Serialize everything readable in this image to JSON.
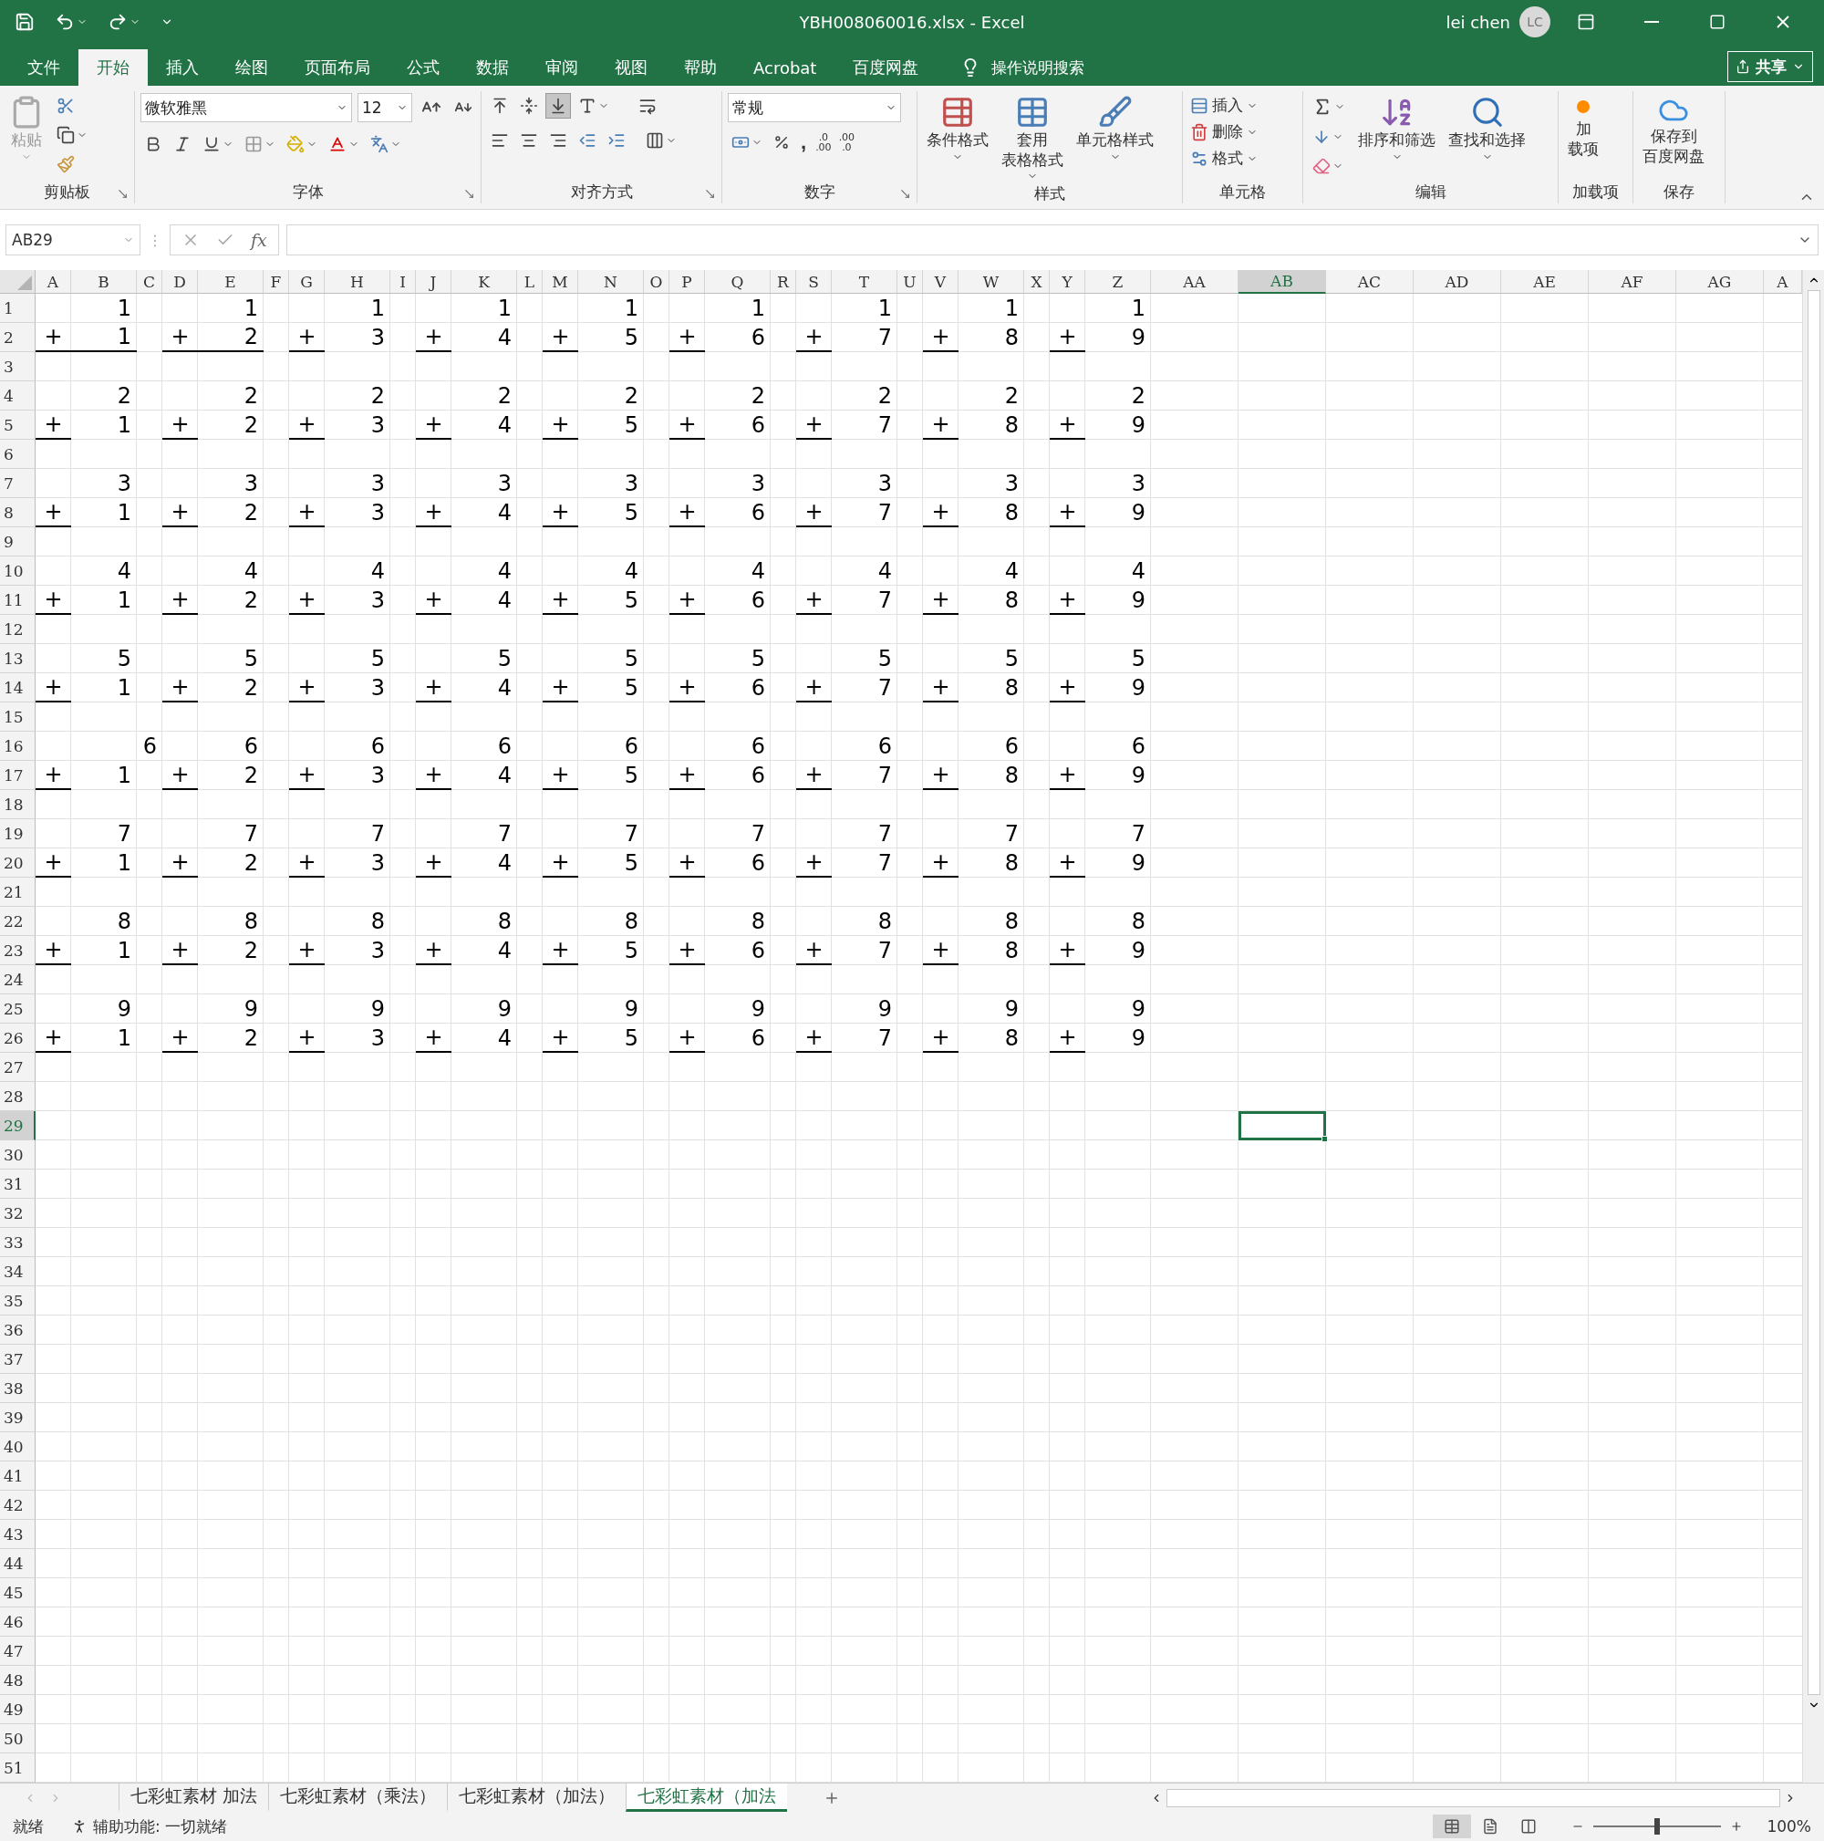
{
  "title_bar": {
    "title": "YBH008060016.xlsx  -  Excel",
    "user": "lei chen",
    "avatar": "LC"
  },
  "menu_tabs": [
    {
      "label": "文件",
      "selected": false
    },
    {
      "label": "开始",
      "selected": true
    },
    {
      "label": "插入",
      "selected": false
    },
    {
      "label": "绘图",
      "selected": false
    },
    {
      "label": "页面布局",
      "selected": false
    },
    {
      "label": "公式",
      "selected": false
    },
    {
      "label": "数据",
      "selected": false
    },
    {
      "label": "审阅",
      "selected": false
    },
    {
      "label": "视图",
      "selected": false
    },
    {
      "label": "帮助",
      "selected": false
    },
    {
      "label": "Acrobat",
      "selected": false
    },
    {
      "label": "百度网盘",
      "selected": false
    }
  ],
  "tell_me": "操作说明搜索",
  "share": "共享",
  "ribbon": {
    "clipboard": {
      "label": "剪贴板",
      "paste": "粘贴"
    },
    "font": {
      "label": "字体",
      "font_name": "微软雅黑",
      "font_size": "12"
    },
    "alignment": {
      "label": "对齐方式",
      "vertical": [
        {
          "kind": "top",
          "selected": false
        },
        {
          "kind": "middle",
          "selected": false
        },
        {
          "kind": "bottom",
          "selected": true
        }
      ]
    },
    "number": {
      "label": "数字",
      "format": "常规",
      "comma": ",",
      "increase_decimal": [
        ".0",
        ".00"
      ],
      "decrease_decimal": [
        ".00",
        ".0"
      ]
    },
    "styles": {
      "label": "样式",
      "buttons": [
        {
          "kind": "conditional",
          "label_lines": [
            "条件格式"
          ]
        },
        {
          "kind": "table",
          "label_lines": [
            "套用",
            "表格格式"
          ]
        },
        {
          "kind": "cell",
          "label_lines": [
            "单元格样式"
          ]
        }
      ]
    },
    "cells": {
      "label": "单元格",
      "buttons": [
        {
          "kind": "insert",
          "label": "插入"
        },
        {
          "kind": "delete",
          "label": "删除"
        },
        {
          "kind": "format",
          "label": "格式"
        }
      ]
    },
    "editing": {
      "label": "编辑",
      "sort": "排序和筛选",
      "find": "查找和选择"
    },
    "addins": {
      "label": "加载项",
      "button_lines": [
        "加",
        "载项"
      ]
    },
    "save": {
      "label": "保存",
      "button_lines": [
        "保存到",
        "百度网盘"
      ]
    }
  },
  "formula_bar": {
    "name_box": "AB29",
    "splitter": "⋮",
    "fx": "fx"
  },
  "columns": [
    {
      "name": "A",
      "selected": false
    },
    {
      "name": "B",
      "selected": false
    },
    {
      "name": "C",
      "selected": false
    },
    {
      "name": "D",
      "selected": false
    },
    {
      "name": "E",
      "selected": false
    },
    {
      "name": "F",
      "selected": false
    },
    {
      "name": "G",
      "selected": false
    },
    {
      "name": "H",
      "selected": false
    },
    {
      "name": "I",
      "selected": false
    },
    {
      "name": "J",
      "selected": false
    },
    {
      "name": "K",
      "selected": false
    },
    {
      "name": "L",
      "selected": false
    },
    {
      "name": "M",
      "selected": false
    },
    {
      "name": "N",
      "selected": false
    },
    {
      "name": "O",
      "selected": false
    },
    {
      "name": "P",
      "selected": false
    },
    {
      "name": "Q",
      "selected": false
    },
    {
      "name": "R",
      "selected": false
    },
    {
      "name": "S",
      "selected": false
    },
    {
      "name": "T",
      "selected": false
    },
    {
      "name": "U",
      "selected": false
    },
    {
      "name": "V",
      "selected": false
    },
    {
      "name": "W",
      "selected": false
    },
    {
      "name": "X",
      "selected": false
    },
    {
      "name": "Y",
      "selected": false
    },
    {
      "name": "Z",
      "selected": false
    },
    {
      "name": "AA",
      "selected": false
    },
    {
      "name": "AB",
      "selected": true
    },
    {
      "name": "AC",
      "selected": false
    },
    {
      "name": "AD",
      "selected": false
    },
    {
      "name": "AE",
      "selected": false
    },
    {
      "name": "AF",
      "selected": false
    },
    {
      "name": "AG",
      "selected": false
    },
    {
      "name": "A",
      "selected": false
    }
  ],
  "rows": [
    {
      "number": "1",
      "selected": false,
      "cells": {
        "B": {
          "text": "1",
          "bottom_border": false
        },
        "E": {
          "text": "1",
          "bottom_border": false
        },
        "H": {
          "text": "1",
          "bottom_border": false
        },
        "K": {
          "text": "1",
          "bottom_border": false
        },
        "N": {
          "text": "1",
          "bottom_border": false
        },
        "Q": {
          "text": "1",
          "bottom_border": false
        },
        "T": {
          "text": "1",
          "bottom_border": false
        },
        "W": {
          "text": "1",
          "bottom_border": false
        },
        "Z": {
          "text": "1",
          "bottom_border": false
        }
      }
    },
    {
      "number": "2",
      "selected": false,
      "cells": {
        "A": {
          "text": "+",
          "bottom_border": true
        },
        "B": {
          "text": "1",
          "bottom_border": true
        },
        "D": {
          "text": "+",
          "bottom_border": true
        },
        "E": {
          "text": "2",
          "bottom_border": true
        },
        "G": {
          "text": "+",
          "bottom_border": true
        },
        "H": {
          "text": "3",
          "bottom_border": false
        },
        "J": {
          "text": "+",
          "bottom_border": true
        },
        "K": {
          "text": "4",
          "bottom_border": false
        },
        "M": {
          "text": "+",
          "bottom_border": true
        },
        "N": {
          "text": "5",
          "bottom_border": false
        },
        "P": {
          "text": "+",
          "bottom_border": true
        },
        "Q": {
          "text": "6",
          "bottom_border": false
        },
        "S": {
          "text": "+",
          "bottom_border": true
        },
        "T": {
          "text": "7",
          "bottom_border": false
        },
        "V": {
          "text": "+",
          "bottom_border": true
        },
        "W": {
          "text": "8",
          "bottom_border": false
        },
        "Y": {
          "text": "+",
          "bottom_border": true
        },
        "Z": {
          "text": "9",
          "bottom_border": false
        }
      }
    },
    {
      "number": "3",
      "selected": false
    },
    {
      "number": "4",
      "selected": false,
      "cells": {
        "B": {
          "text": "2",
          "bottom_border": false
        },
        "E": {
          "text": "2",
          "bottom_border": false
        },
        "H": {
          "text": "2",
          "bottom_border": false
        },
        "K": {
          "text": "2",
          "bottom_border": false
        },
        "N": {
          "text": "2",
          "bottom_border": false
        },
        "Q": {
          "text": "2",
          "bottom_border": false
        },
        "T": {
          "text": "2",
          "bottom_border": false
        },
        "W": {
          "text": "2",
          "bottom_border": false
        },
        "Z": {
          "text": "2",
          "bottom_border": false
        }
      }
    },
    {
      "number": "5",
      "selected": false,
      "cells": {
        "A": {
          "text": "+",
          "bottom_border": true
        },
        "B": {
          "text": "1",
          "bottom_border": false
        },
        "D": {
          "text": "+",
          "bottom_border": true
        },
        "E": {
          "text": "2",
          "bottom_border": false
        },
        "G": {
          "text": "+",
          "bottom_border": true
        },
        "H": {
          "text": "3",
          "bottom_border": false
        },
        "J": {
          "text": "+",
          "bottom_border": true
        },
        "K": {
          "text": "4",
          "bottom_border": false
        },
        "M": {
          "text": "+",
          "bottom_border": true
        },
        "N": {
          "text": "5",
          "bottom_border": false
        },
        "P": {
          "text": "+",
          "bottom_border": true
        },
        "Q": {
          "text": "6",
          "bottom_border": false
        },
        "S": {
          "text": "+",
          "bottom_border": true
        },
        "T": {
          "text": "7",
          "bottom_border": false
        },
        "V": {
          "text": "+",
          "bottom_border": true
        },
        "W": {
          "text": "8",
          "bottom_border": false
        },
        "Y": {
          "text": "+",
          "bottom_border": true
        },
        "Z": {
          "text": "9",
          "bottom_border": false
        }
      }
    },
    {
      "number": "6",
      "selected": false
    },
    {
      "number": "7",
      "selected": false,
      "cells": {
        "B": {
          "text": "3",
          "bottom_border": false
        },
        "E": {
          "text": "3",
          "bottom_border": false
        },
        "H": {
          "text": "3",
          "bottom_border": false
        },
        "K": {
          "text": "3",
          "bottom_border": false
        },
        "N": {
          "text": "3",
          "bottom_border": false
        },
        "Q": {
          "text": "3",
          "bottom_border": false
        },
        "T": {
          "text": "3",
          "bottom_border": false
        },
        "W": {
          "text": "3",
          "bottom_border": false
        },
        "Z": {
          "text": "3",
          "bottom_border": false
        }
      }
    },
    {
      "number": "8",
      "selected": false,
      "cells": {
        "A": {
          "text": "+",
          "bottom_border": true
        },
        "B": {
          "text": "1",
          "bottom_border": false
        },
        "D": {
          "text": "+",
          "bottom_border": true
        },
        "E": {
          "text": "2",
          "bottom_border": false
        },
        "G": {
          "text": "+",
          "bottom_border": true
        },
        "H": {
          "text": "3",
          "bottom_border": false
        },
        "J": {
          "text": "+",
          "bottom_border": true
        },
        "K": {
          "text": "4",
          "bottom_border": false
        },
        "M": {
          "text": "+",
          "bottom_border": true
        },
        "N": {
          "text": "5",
          "bottom_border": false
        },
        "P": {
          "text": "+",
          "bottom_border": true
        },
        "Q": {
          "text": "6",
          "bottom_border": false
        },
        "S": {
          "text": "+",
          "bottom_border": true
        },
        "T": {
          "text": "7",
          "bottom_border": false
        },
        "V": {
          "text": "+",
          "bottom_border": true
        },
        "W": {
          "text": "8",
          "bottom_border": false
        },
        "Y": {
          "text": "+",
          "bottom_border": true
        },
        "Z": {
          "text": "9",
          "bottom_border": false
        }
      }
    },
    {
      "number": "9",
      "selected": false
    },
    {
      "number": "10",
      "selected": false,
      "cells": {
        "B": {
          "text": "4",
          "bottom_border": false
        },
        "E": {
          "text": "4",
          "bottom_border": false
        },
        "H": {
          "text": "4",
          "bottom_border": false
        },
        "K": {
          "text": "4",
          "bottom_border": false
        },
        "N": {
          "text": "4",
          "bottom_border": false
        },
        "Q": {
          "text": "4",
          "bottom_border": false
        },
        "T": {
          "text": "4",
          "bottom_border": false
        },
        "W": {
          "text": "4",
          "bottom_border": false
        },
        "Z": {
          "text": "4",
          "bottom_border": false
        }
      }
    },
    {
      "number": "11",
      "selected": false,
      "cells": {
        "A": {
          "text": "+",
          "bottom_border": true
        },
        "B": {
          "text": "1",
          "bottom_border": false
        },
        "D": {
          "text": "+",
          "bottom_border": true
        },
        "E": {
          "text": "2",
          "bottom_border": false
        },
        "G": {
          "text": "+",
          "bottom_border": true
        },
        "H": {
          "text": "3",
          "bottom_border": false
        },
        "J": {
          "text": "+",
          "bottom_border": true
        },
        "K": {
          "text": "4",
          "bottom_border": false
        },
        "M": {
          "text": "+",
          "bottom_border": true
        },
        "N": {
          "text": "5",
          "bottom_border": false
        },
        "P": {
          "text": "+",
          "bottom_border": true
        },
        "Q": {
          "text": "6",
          "bottom_border": false
        },
        "S": {
          "text": "+",
          "bottom_border": true
        },
        "T": {
          "text": "7",
          "bottom_border": false
        },
        "V": {
          "text": "+",
          "bottom_border": true
        },
        "W": {
          "text": "8",
          "bottom_border": false
        },
        "Y": {
          "text": "+",
          "bottom_border": true
        },
        "Z": {
          "text": "9",
          "bottom_border": false
        }
      }
    },
    {
      "number": "12",
      "selected": false
    },
    {
      "number": "13",
      "selected": false,
      "cells": {
        "B": {
          "text": "5",
          "bottom_border": false
        },
        "E": {
          "text": "5",
          "bottom_border": false
        },
        "H": {
          "text": "5",
          "bottom_border": false
        },
        "K": {
          "text": "5",
          "bottom_border": false
        },
        "N": {
          "text": "5",
          "bottom_border": false
        },
        "Q": {
          "text": "5",
          "bottom_border": false
        },
        "T": {
          "text": "5",
          "bottom_border": false
        },
        "W": {
          "text": "5",
          "bottom_border": false
        },
        "Z": {
          "text": "5",
          "bottom_border": false
        }
      }
    },
    {
      "number": "14",
      "selected": false,
      "cells": {
        "A": {
          "text": "+",
          "bottom_border": true
        },
        "B": {
          "text": "1",
          "bottom_border": false
        },
        "D": {
          "text": "+",
          "bottom_border": true
        },
        "E": {
          "text": "2",
          "bottom_border": false
        },
        "G": {
          "text": "+",
          "bottom_border": true
        },
        "H": {
          "text": "3",
          "bottom_border": false
        },
        "J": {
          "text": "+",
          "bottom_border": true
        },
        "K": {
          "text": "4",
          "bottom_border": false
        },
        "M": {
          "text": "+",
          "bottom_border": true
        },
        "N": {
          "text": "5",
          "bottom_border": false
        },
        "P": {
          "text": "+",
          "bottom_border": true
        },
        "Q": {
          "text": "6",
          "bottom_border": false
        },
        "S": {
          "text": "+",
          "bottom_border": true
        },
        "T": {
          "text": "7",
          "bottom_border": false
        },
        "V": {
          "text": "+",
          "bottom_border": true
        },
        "W": {
          "text": "8",
          "bottom_border": false
        },
        "Y": {
          "text": "+",
          "bottom_border": true
        },
        "Z": {
          "text": "9",
          "bottom_border": false
        }
      }
    },
    {
      "number": "15",
      "selected": false
    },
    {
      "number": "16",
      "selected": false,
      "cells": {
        "C": {
          "text": "6",
          "bottom_border": false
        },
        "E": {
          "text": "6",
          "bottom_border": false
        },
        "H": {
          "text": "6",
          "bottom_border": false
        },
        "K": {
          "text": "6",
          "bottom_border": false
        },
        "N": {
          "text": "6",
          "bottom_border": false
        },
        "Q": {
          "text": "6",
          "bottom_border": false
        },
        "T": {
          "text": "6",
          "bottom_border": false
        },
        "W": {
          "text": "6",
          "bottom_border": false
        },
        "Z": {
          "text": "6",
          "bottom_border": false
        }
      }
    },
    {
      "number": "17",
      "selected": false,
      "cells": {
        "A": {
          "text": "+",
          "bottom_border": true
        },
        "B": {
          "text": "1",
          "bottom_border": false
        },
        "D": {
          "text": "+",
          "bottom_border": true
        },
        "E": {
          "text": "2",
          "bottom_border": false
        },
        "G": {
          "text": "+",
          "bottom_border": true
        },
        "H": {
          "text": "3",
          "bottom_border": false
        },
        "J": {
          "text": "+",
          "bottom_border": true
        },
        "K": {
          "text": "4",
          "bottom_border": false
        },
        "M": {
          "text": "+",
          "bottom_border": true
        },
        "N": {
          "text": "5",
          "bottom_border": false
        },
        "P": {
          "text": "+",
          "bottom_border": true
        },
        "Q": {
          "text": "6",
          "bottom_border": false
        },
        "S": {
          "text": "+",
          "bottom_border": true
        },
        "T": {
          "text": "7",
          "bottom_border": false
        },
        "V": {
          "text": "+",
          "bottom_border": true
        },
        "W": {
          "text": "8",
          "bottom_border": false
        },
        "Y": {
          "text": "+",
          "bottom_border": true
        },
        "Z": {
          "text": "9",
          "bottom_border": false
        }
      }
    },
    {
      "number": "18",
      "selected": false
    },
    {
      "number": "19",
      "selected": false,
      "cells": {
        "B": {
          "text": "7",
          "bottom_border": false
        },
        "E": {
          "text": "7",
          "bottom_border": false
        },
        "H": {
          "text": "7",
          "bottom_border": false
        },
        "K": {
          "text": "7",
          "bottom_border": false
        },
        "N": {
          "text": "7",
          "bottom_border": false
        },
        "Q": {
          "text": "7",
          "bottom_border": false
        },
        "T": {
          "text": "7",
          "bottom_border": false
        },
        "W": {
          "text": "7",
          "bottom_border": false
        },
        "Z": {
          "text": "7",
          "bottom_border": false
        }
      }
    },
    {
      "number": "20",
      "selected": false,
      "cells": {
        "A": {
          "text": "+",
          "bottom_border": true
        },
        "B": {
          "text": "1",
          "bottom_border": false
        },
        "D": {
          "text": "+",
          "bottom_border": true
        },
        "E": {
          "text": "2",
          "bottom_border": false
        },
        "G": {
          "text": "+",
          "bottom_border": true
        },
        "H": {
          "text": "3",
          "bottom_border": false
        },
        "J": {
          "text": "+",
          "bottom_border": true
        },
        "K": {
          "text": "4",
          "bottom_border": false
        },
        "M": {
          "text": "+",
          "bottom_border": true
        },
        "N": {
          "text": "5",
          "bottom_border": false
        },
        "P": {
          "text": "+",
          "bottom_border": true
        },
        "Q": {
          "text": "6",
          "bottom_border": false
        },
        "S": {
          "text": "+",
          "bottom_border": true
        },
        "T": {
          "text": "7",
          "bottom_border": false
        },
        "V": {
          "text": "+",
          "bottom_border": true
        },
        "W": {
          "text": "8",
          "bottom_border": false
        },
        "Y": {
          "text": "+",
          "bottom_border": true
        },
        "Z": {
          "text": "9",
          "bottom_border": false
        }
      }
    },
    {
      "number": "21",
      "selected": false
    },
    {
      "number": "22",
      "selected": false,
      "cells": {
        "B": {
          "text": "8",
          "bottom_border": false
        },
        "E": {
          "text": "8",
          "bottom_border": false
        },
        "H": {
          "text": "8",
          "bottom_border": false
        },
        "K": {
          "text": "8",
          "bottom_border": false
        },
        "N": {
          "text": "8",
          "bottom_border": false
        },
        "Q": {
          "text": "8",
          "bottom_border": false
        },
        "T": {
          "text": "8",
          "bottom_border": false
        },
        "W": {
          "text": "8",
          "bottom_border": false
        },
        "Z": {
          "text": "8",
          "bottom_border": false
        }
      }
    },
    {
      "number": "23",
      "selected": false,
      "cells": {
        "A": {
          "text": "+",
          "bottom_border": true
        },
        "B": {
          "text": "1",
          "bottom_border": false
        },
        "D": {
          "text": "+",
          "bottom_border": true
        },
        "E": {
          "text": "2",
          "bottom_border": false
        },
        "G": {
          "text": "+",
          "bottom_border": true
        },
        "H": {
          "text": "3",
          "bottom_border": false
        },
        "J": {
          "text": "+",
          "bottom_border": true
        },
        "K": {
          "text": "4",
          "bottom_border": false
        },
        "M": {
          "text": "+",
          "bottom_border": true
        },
        "N": {
          "text": "5",
          "bottom_border": false
        },
        "P": {
          "text": "+",
          "bottom_border": true
        },
        "Q": {
          "text": "6",
          "bottom_border": false
        },
        "S": {
          "text": "+",
          "bottom_border": true
        },
        "T": {
          "text": "7",
          "bottom_border": false
        },
        "V": {
          "text": "+",
          "bottom_border": true
        },
        "W": {
          "text": "8",
          "bottom_border": false
        },
        "Y": {
          "text": "+",
          "bottom_border": true
        },
        "Z": {
          "text": "9",
          "bottom_border": false
        }
      }
    },
    {
      "number": "24",
      "selected": false
    },
    {
      "number": "25",
      "selected": false,
      "cells": {
        "B": {
          "text": "9",
          "bottom_border": false
        },
        "E": {
          "text": "9",
          "bottom_border": false
        },
        "H": {
          "text": "9",
          "bottom_border": false
        },
        "K": {
          "text": "9",
          "bottom_border": false
        },
        "N": {
          "text": "9",
          "bottom_border": false
        },
        "Q": {
          "text": "9",
          "bottom_border": false
        },
        "T": {
          "text": "9",
          "bottom_border": false
        },
        "W": {
          "text": "9",
          "bottom_border": false
        },
        "Z": {
          "text": "9",
          "bottom_border": false
        }
      }
    },
    {
      "number": "26",
      "selected": false,
      "cells": {
        "A": {
          "text": "+",
          "bottom_border": true
        },
        "B": {
          "text": "1",
          "bottom_border": false
        },
        "D": {
          "text": "+",
          "bottom_border": true
        },
        "E": {
          "text": "2",
          "bottom_border": false
        },
        "G": {
          "text": "+",
          "bottom_border": true
        },
        "H": {
          "text": "3",
          "bottom_border": false
        },
        "J": {
          "text": "+",
          "bottom_border": true
        },
        "K": {
          "text": "4",
          "bottom_border": false
        },
        "M": {
          "text": "+",
          "bottom_border": true
        },
        "N": {
          "text": "5",
          "bottom_border": false
        },
        "P": {
          "text": "+",
          "bottom_border": true
        },
        "Q": {
          "text": "6",
          "bottom_border": false
        },
        "S": {
          "text": "+",
          "bottom_border": true
        },
        "T": {
          "text": "7",
          "bottom_border": false
        },
        "V": {
          "text": "+",
          "bottom_border": true
        },
        "W": {
          "text": "8",
          "bottom_border": false
        },
        "Y": {
          "text": "+",
          "bottom_border": true
        },
        "Z": {
          "text": "9",
          "bottom_border": false
        }
      }
    },
    {
      "number": "27",
      "selected": false
    },
    {
      "number": "28",
      "selected": false
    },
    {
      "number": "29",
      "selected": true
    },
    {
      "number": "30",
      "selected": false
    },
    {
      "number": "31",
      "selected": false
    },
    {
      "number": "32",
      "selected": false
    },
    {
      "number": "33",
      "selected": false
    },
    {
      "number": "34",
      "selected": false
    },
    {
      "number": "35",
      "selected": false
    },
    {
      "number": "36",
      "selected": false
    },
    {
      "number": "37",
      "selected": false
    },
    {
      "number": "38",
      "selected": false
    },
    {
      "number": "39",
      "selected": false
    },
    {
      "number": "40",
      "selected": false
    },
    {
      "number": "41",
      "selected": false
    },
    {
      "number": "42",
      "selected": false
    },
    {
      "number": "43",
      "selected": false
    },
    {
      "number": "44",
      "selected": false
    },
    {
      "number": "45",
      "selected": false
    },
    {
      "number": "46",
      "selected": false
    },
    {
      "number": "47",
      "selected": false
    },
    {
      "number": "48",
      "selected": false
    },
    {
      "number": "49",
      "selected": false
    },
    {
      "number": "50",
      "selected": false
    },
    {
      "number": "51",
      "selected": false
    }
  ],
  "sheet_tabs": [
    {
      "label": "七彩虹素材 加法",
      "selected": false
    },
    {
      "label": "七彩虹素材（乘法）",
      "selected": false
    },
    {
      "label": "七彩虹素材（加法）",
      "selected": false
    },
    {
      "label": "七彩虹素材（加法",
      "selected": true
    }
  ],
  "status_bar": {
    "ready": "就绪",
    "accessibility": "辅助功能: 一切就绪",
    "zoom": "100%",
    "zoom_slider": {
      "level": 0.5
    }
  }
}
